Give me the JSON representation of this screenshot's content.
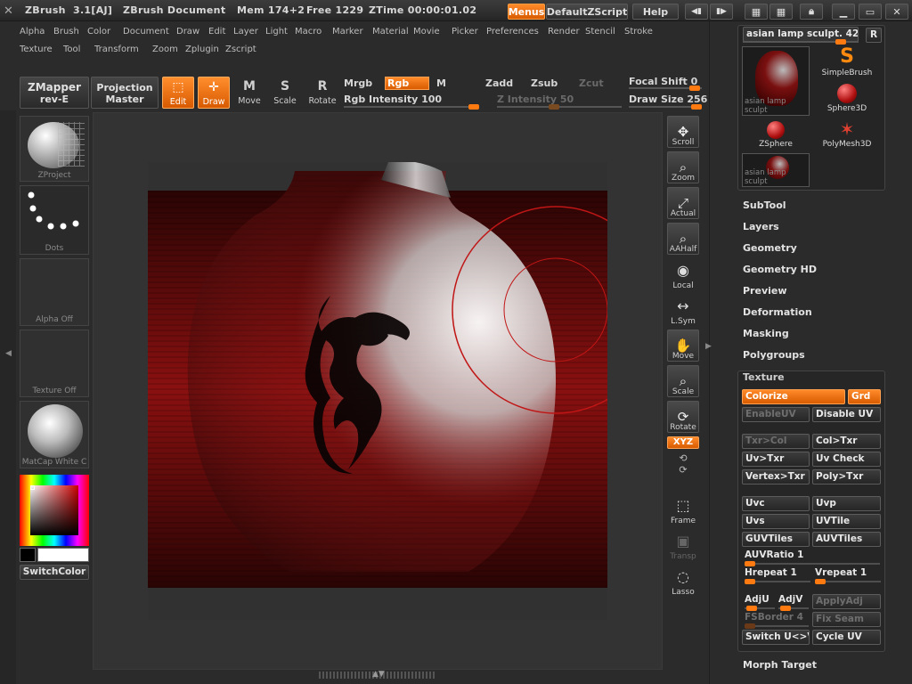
{
  "titlebar": {
    "app": "ZBrush",
    "version": "3.1[AJ]",
    "document": "ZBrush Document",
    "mem": "Mem 174+2",
    "free": "Free 1229",
    "ztime": "ZTime 00:00:01.02",
    "menus_button": "Menus",
    "script_button": "DefaultZScript",
    "help_button": "Help"
  },
  "menu_row1": [
    "Alpha",
    "Brush",
    "Color",
    "Document",
    "Draw",
    "Edit",
    "Layer",
    "Light",
    "Macro",
    "Marker",
    "Material",
    "Movie",
    "Picker",
    "Preferences",
    "Render",
    "Stencil",
    "Stroke"
  ],
  "menu_row2": [
    "Texture",
    "Tool",
    "Transform",
    "Zoom",
    "Zplugin",
    "Zscript"
  ],
  "toolbar": {
    "zmapper": "ZMapper",
    "zmapper_sub": "rev-E",
    "projection": "Projection",
    "projection_sub": "Master",
    "edit": "Edit",
    "draw": "Draw",
    "move": "Move",
    "scale": "Scale",
    "rotate": "Rotate",
    "mrgb": "Mrgb",
    "rgb": "Rgb",
    "m": "M",
    "rgb_intensity": "Rgb Intensity 100",
    "zadd": "Zadd",
    "zsub": "Zsub",
    "zcut": "Zcut",
    "z_intensity": "Z Intensity 50",
    "focal_shift": "Focal Shift 0",
    "draw_size": "Draw Size 256"
  },
  "left_shelf": {
    "zproject": "ZProject",
    "dots": "Dots",
    "alpha": "Alpha Off",
    "texture": "Texture Off",
    "matcap": "MatCap White C",
    "switch_color": "SwitchColor"
  },
  "canvas_tools": [
    "Scroll",
    "Zoom",
    "Actual",
    "AAHalf",
    "Local",
    "L.Sym",
    "Move",
    "Scale",
    "Rotate",
    "XYZ",
    "Frame",
    "Transp",
    "Lasso"
  ],
  "tool_palette": {
    "current_tool": "asian lamp sculpt. 42",
    "r_button": "R",
    "items": [
      {
        "label": "asian lamp sculpt"
      },
      {
        "label": "SimpleBrush"
      },
      {
        "label": "Sphere3D"
      },
      {
        "label": "ZSphere"
      },
      {
        "label": "PolyMesh3D"
      },
      {
        "label": "asian lamp sculpt"
      }
    ]
  },
  "palette_sections": [
    "SubTool",
    "Layers",
    "Geometry",
    "Geometry HD",
    "Preview",
    "Deformation",
    "Masking",
    "Polygroups"
  ],
  "texture_palette": {
    "title": "Texture",
    "colorize": "Colorize",
    "grd": "Grd",
    "enable_uv": "EnableUV",
    "disable_uv": "Disable UV",
    "txr_col": "Txr>Col",
    "col_txr": "Col>Txr",
    "uv_txr": "Uv>Txr",
    "uv_check": "Uv Check",
    "vertex_txr": "Vertex>Txr",
    "poly_txr": "Poly>Txr",
    "uvc": "Uvc",
    "uvp": "Uvp",
    "uvs": "Uvs",
    "uvtile": "UVTile",
    "guvtiles": "GUVTiles",
    "auvtiles": "AUVTiles",
    "auvratio": "AUVRatio 1",
    "hrepeat": "Hrepeat 1",
    "vrepeat": "Vrepeat 1",
    "adju": "AdjU",
    "adjv": "AdjV",
    "applyadj": "ApplyAdj",
    "fsborder": "FSBorder 4",
    "fix_seam": "Fix Seam",
    "switch_uv": "Switch U<>V",
    "cycle_uv": "Cycle UV"
  },
  "morph_target": "Morph Target",
  "colors": {
    "accent": "#ff7a10",
    "panel": "#2b2b2b",
    "canvas_red": "#7a0c0c"
  }
}
